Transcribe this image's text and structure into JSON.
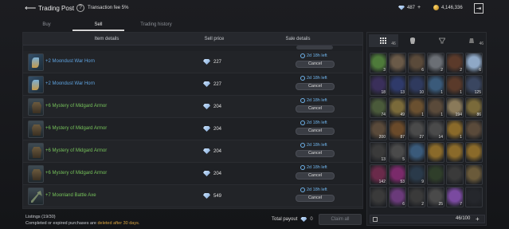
{
  "header": {
    "title": "Trading Post",
    "help": "?",
    "fee": "Transaction fee 5%",
    "diamonds": "487",
    "gold": "4,146,336"
  },
  "tabs": [
    {
      "label": "Buy"
    },
    {
      "label": "Sell"
    },
    {
      "label": "Trading history"
    }
  ],
  "table": {
    "headers": [
      "Item details",
      "Sell price",
      "Sale details"
    ],
    "rows": [
      {
        "name": "+2 Moondust War Horn",
        "price": "227",
        "time": "2d 18h left",
        "cancel": "Cancel",
        "kind": "horn",
        "color": "blue"
      },
      {
        "name": "+2 Moondust War Horn",
        "price": "227",
        "time": "2d 18h left",
        "cancel": "Cancel",
        "kind": "horn",
        "color": "blue"
      },
      {
        "name": "+6 Mystery of Midgard Armor",
        "price": "204",
        "time": "2d 18h left",
        "cancel": "Cancel",
        "kind": "armor",
        "color": "green"
      },
      {
        "name": "+6 Mystery of Midgard Armor",
        "price": "204",
        "time": "2d 18h left",
        "cancel": "Cancel",
        "kind": "armor",
        "color": "green"
      },
      {
        "name": "+6 Mystery of Midgard Armor",
        "price": "204",
        "time": "2d 18h left",
        "cancel": "Cancel",
        "kind": "armor",
        "color": "green"
      },
      {
        "name": "+6 Mystery of Midgard Armor",
        "price": "204",
        "time": "2d 18h left",
        "cancel": "Cancel",
        "kind": "armor",
        "color": "green"
      },
      {
        "name": "+7 Moonland Battle Axe",
        "price": "549",
        "time": "2d 18h left",
        "cancel": "Cancel",
        "kind": "axe",
        "color": "green"
      }
    ]
  },
  "footer": {
    "listings": "Listings (19/30)",
    "note_pre": "Completed or expired purchases are ",
    "note_hl": "deleted after 30 days.",
    "payout_label": "Total payout",
    "payout_value": "0",
    "claim": "Claim all"
  },
  "inventory": {
    "tabs": [
      {
        "count": "46"
      },
      {
        "count": ""
      },
      {
        "count": ""
      },
      {
        "count": "46"
      }
    ],
    "capacity": "46/100",
    "cells": [
      {
        "c": "3",
        "bg": "#4e7a3a"
      },
      {
        "c": "",
        "bg": "#6a5a48"
      },
      {
        "c": "6",
        "bg": "#5a4a3a"
      },
      {
        "c": "2",
        "bg": "#6b6f75"
      },
      {
        "c": "2",
        "bg": "#5b3a2a"
      },
      {
        "c": "6",
        "bg": "#8fa8c6"
      },
      {
        "c": "18",
        "bg": "#3a2f5a"
      },
      {
        "c": "13",
        "bg": "#2f3a6a"
      },
      {
        "c": "10",
        "bg": "#2f3a5e"
      },
      {
        "c": "1",
        "bg": "#3a5a7a"
      },
      {
        "c": "1",
        "bg": "#5a3a2a"
      },
      {
        "c": "125",
        "bg": "#3a4660"
      },
      {
        "c": "74",
        "bg": "#4a5a3a"
      },
      {
        "c": "49",
        "bg": "#7a6a3a"
      },
      {
        "c": "1",
        "bg": "#6a5030"
      },
      {
        "c": "1",
        "bg": "#5a4a3a"
      },
      {
        "c": "194",
        "bg": "#8a7a5a"
      },
      {
        "c": "86",
        "bg": "#7a6a3a"
      },
      {
        "c": "200",
        "bg": "#5a4a3a"
      },
      {
        "c": "87",
        "bg": "#6a4a2a"
      },
      {
        "c": "27",
        "bg": "#4a4a4a"
      },
      {
        "c": "14",
        "bg": "#4a4a4a"
      },
      {
        "c": "1",
        "bg": "#8a6a2a"
      },
      {
        "c": "",
        "bg": "#5a4a3a"
      },
      {
        "c": "13",
        "bg": "#3a3a3a"
      },
      {
        "c": "5",
        "bg": "#4a4a4a"
      },
      {
        "c": "",
        "bg": "#3a5a7a"
      },
      {
        "c": "",
        "bg": "#8a6a2a"
      },
      {
        "c": "",
        "bg": "#8a6a2a"
      },
      {
        "c": "",
        "bg": "#8a6a2a"
      },
      {
        "c": "142",
        "bg": "#6a2a4a"
      },
      {
        "c": "53",
        "bg": "#7a2a6a"
      },
      {
        "c": "9",
        "bg": "#2a3a4a"
      },
      {
        "c": "",
        "bg": "#2f3e2a"
      },
      {
        "c": "",
        "bg": "#3a3a3a"
      },
      {
        "c": "",
        "bg": "#6a5a3a"
      },
      {
        "c": "",
        "bg": "#3a3a3a"
      },
      {
        "c": "6",
        "bg": "#6a3a7a"
      },
      {
        "c": "2",
        "bg": "#3a3a3a"
      },
      {
        "c": "25",
        "bg": "#4a4a4a"
      },
      {
        "c": "7",
        "bg": "#7a4aa0"
      },
      {
        "c": "",
        "bg": "#25272c"
      }
    ]
  }
}
